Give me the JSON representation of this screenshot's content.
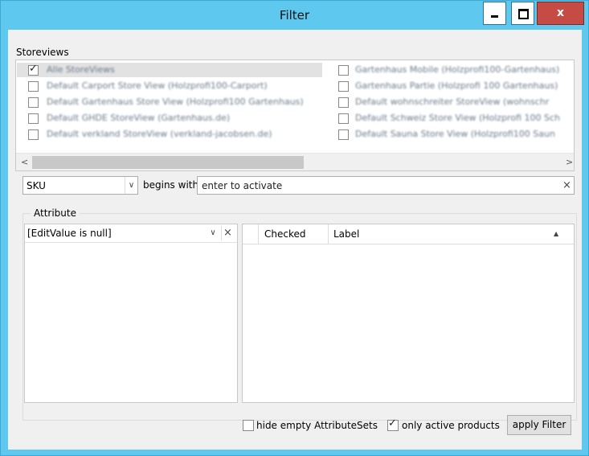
{
  "window": {
    "title": "Filter",
    "close_glyph": "x"
  },
  "storeviews": {
    "label": "Storeviews",
    "items_left": [
      {
        "label": "Alle StoreViews",
        "checked": true
      },
      {
        "label": "Default Carport Store View (Holzprofi100-Carport)",
        "checked": false
      },
      {
        "label": "Default Gartenhaus Store View (Holzprofi100 Gartenhaus)",
        "checked": false
      },
      {
        "label": "Default GHDE StoreView (Gartenhaus.de)",
        "checked": false
      },
      {
        "label": "Default verkland StoreView (verkland-jacobsen.de)",
        "checked": false
      }
    ],
    "items_right": [
      {
        "label": "Gartenhaus Mobile (Holzprofi100-Gartenhaus)",
        "checked": false
      },
      {
        "label": "Gartenhaus Partie (Holzprofi 100 Gartenhaus)",
        "checked": false
      },
      {
        "label": "Default wohnschreiter StoreView (wohnschr",
        "checked": false
      },
      {
        "label": "Default Schweiz Store View (Holzprofi 100 Sch",
        "checked": false
      },
      {
        "label": "Default Sauna Store View (Holzprofi100 Saun",
        "checked": false
      }
    ]
  },
  "filter_row": {
    "field_value": "SKU",
    "operator_label": "begins with",
    "input_value": "enter to activate"
  },
  "attribute": {
    "group_label": "Attribute",
    "combo_value": "[EditValue is null]",
    "grid_columns": [
      "Checked",
      "Label"
    ]
  },
  "footer": {
    "hide_empty_label": "hide empty AttributeSets",
    "hide_empty_checked": false,
    "only_active_label": "only active products",
    "only_active_checked": true,
    "apply_label": "apply Filter"
  }
}
